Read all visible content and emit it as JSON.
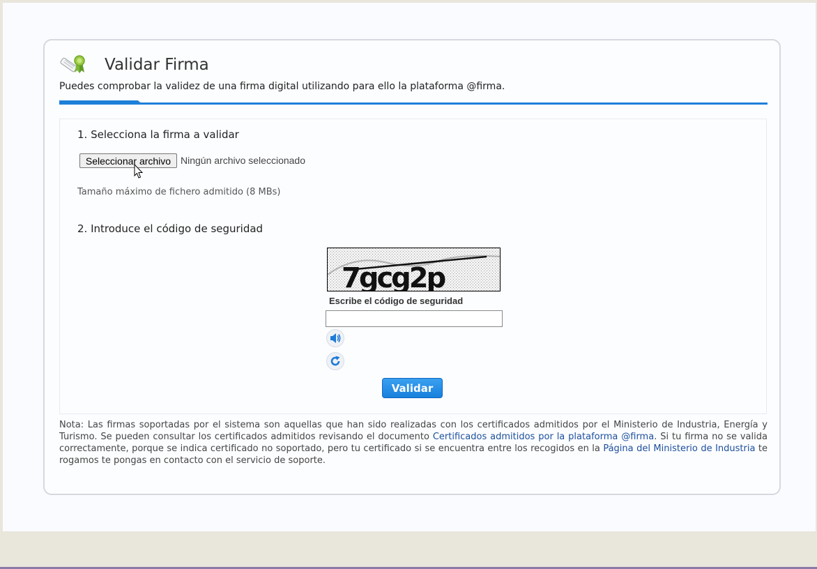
{
  "header": {
    "title": "Validar Firma",
    "subtitle": "Puedes comprobar la validez de una firma digital utilizando para ello la plataforma @firma."
  },
  "step1": {
    "title": "1. Selecciona la firma a validar",
    "file_button": "Seleccionar archivo",
    "file_status": "Ningún archivo seleccionado",
    "max_size": "Tamaño máximo de fichero admitido (8 MBs)"
  },
  "step2": {
    "title": "2. Introduce el código de seguridad",
    "captcha_text": "7gcg2p",
    "captcha_label": "Escribe el código de seguridad",
    "captcha_value": "",
    "audio_icon": "speaker-icon",
    "refresh_icon": "refresh-icon"
  },
  "actions": {
    "validate_label": "Validar"
  },
  "note": {
    "part1": "Nota: Las firmas soportadas por el sistema son aquellas que han sido realizadas con los certificados admitidos por el Ministerio de Industria, Energía y Turismo. Se pueden consultar los certificados admitidos revisando el documento ",
    "link1": "Certificados admitidos por la plataforma @firma",
    "part2": ". Si tu firma no se valida correctamente, porque se indica certificado no soportado, pero tu certificado si se encuentra entre los recogidos en la ",
    "link2": "Página del Ministerio de Industria",
    "part3": " te rogamos te pongas en contacto con el servicio de soporte."
  },
  "colors": {
    "accent": "#1e7fd8",
    "link": "#1c4f9c"
  }
}
